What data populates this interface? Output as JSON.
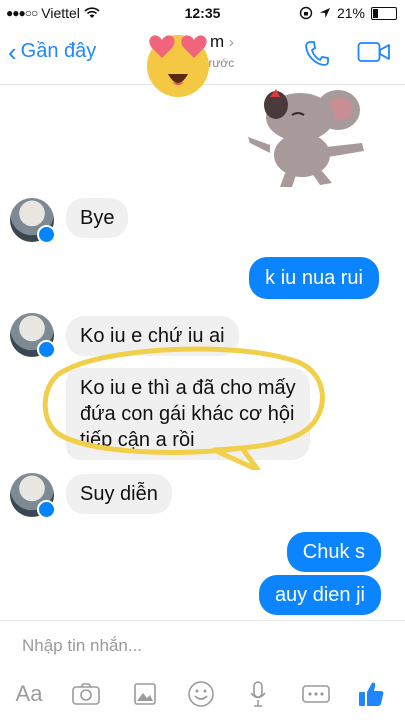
{
  "status": {
    "carrier": "Viettel",
    "time": "12:35",
    "battery": "21%",
    "battery_level": 0.21
  },
  "header": {
    "back_label": "Gần đây",
    "contact_partial": "m",
    "subtitle": "trước"
  },
  "messages": [
    {
      "from": "them",
      "text": "Bye"
    },
    {
      "from": "me",
      "text": "k iu nua rui"
    },
    {
      "from": "them",
      "text": "Ko iu e chứ iu ai"
    },
    {
      "from": "them",
      "lines": [
        "Ko iu e thì a đã cho mấy",
        "đứa con gái khác cơ hội",
        "tiếp cận a rồi"
      ]
    },
    {
      "from": "them",
      "text": "Suy diễn"
    },
    {
      "from": "me",
      "text": "Chuk s"
    },
    {
      "from": "me",
      "text": "auy dien ji"
    }
  ],
  "composer": {
    "placeholder": "Nhập tin nhắn...",
    "aa_label": "Aa"
  },
  "colors": {
    "accent": "#1f86ff",
    "outgoing_bubble": "#0a84ff",
    "incoming_bubble": "#f1f0f0",
    "highlight": "#f2cf4a"
  },
  "icons": [
    "wifi-icon",
    "location-icon",
    "lock-rotation-icon",
    "phone-icon",
    "video-icon",
    "camera-icon",
    "gallery-icon",
    "emoji-icon",
    "microphone-icon",
    "more-icon",
    "like-icon"
  ]
}
